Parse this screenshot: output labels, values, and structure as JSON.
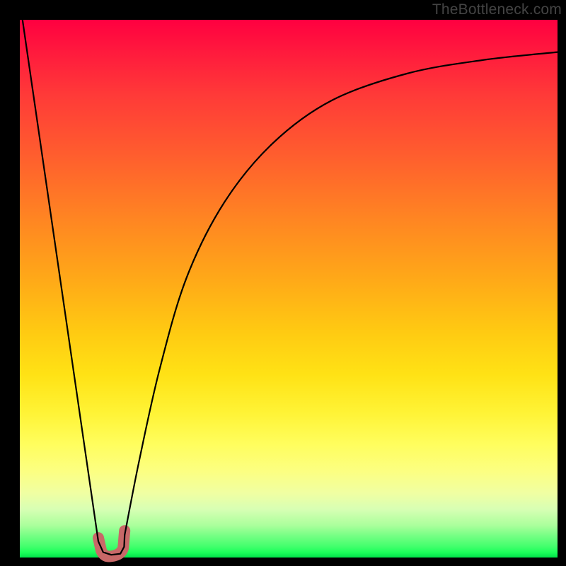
{
  "watermark": "TheBottleneck.com",
  "chart_data": {
    "type": "line",
    "title": "",
    "xlabel": "",
    "ylabel": "",
    "xlim": [
      0,
      100
    ],
    "ylim": [
      0,
      100
    ],
    "background": "vertical-gradient-red-to-green",
    "curve": {
      "description": "V-shaped bottleneck curve; steep linear descent from top-left to a minimum near x≈17 at y≈0, then asymptotic rise toward ~94 at right edge",
      "minimum_x": 17,
      "minimum_y": 0.5,
      "left_branch": [
        {
          "x": 0.5,
          "y": 100
        },
        {
          "x": 14.6,
          "y": 3
        },
        {
          "x": 15.5,
          "y": 1
        },
        {
          "x": 17.0,
          "y": 0.5
        }
      ],
      "hook": [
        {
          "x": 17.0,
          "y": 0.5
        },
        {
          "x": 18.7,
          "y": 0.7
        },
        {
          "x": 19.4,
          "y": 2.0
        },
        {
          "x": 19.5,
          "y": 4.2
        }
      ],
      "right_branch": [
        {
          "x": 19.5,
          "y": 4.2
        },
        {
          "x": 22.2,
          "y": 18
        },
        {
          "x": 26,
          "y": 35
        },
        {
          "x": 31,
          "y": 52
        },
        {
          "x": 38,
          "y": 66
        },
        {
          "x": 47,
          "y": 77
        },
        {
          "x": 58,
          "y": 85
        },
        {
          "x": 72,
          "y": 90
        },
        {
          "x": 86,
          "y": 92.5
        },
        {
          "x": 100,
          "y": 94
        }
      ]
    },
    "marker": {
      "x_range": [
        14.6,
        19.5
      ],
      "y": 0.5,
      "color": "#c86868",
      "stroke_width_px": 16,
      "shape": "J"
    }
  }
}
